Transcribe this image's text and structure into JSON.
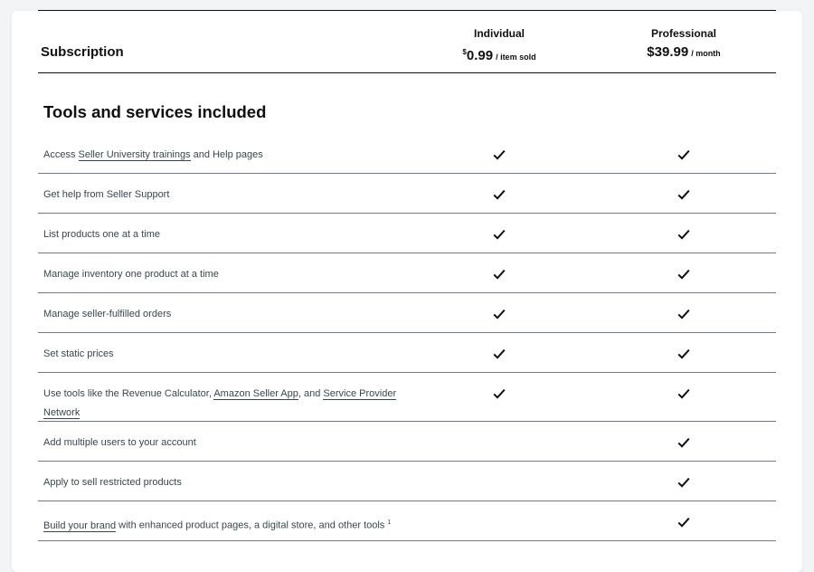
{
  "header": {
    "subscription_label": "Subscription",
    "plans": [
      {
        "name": "Individual",
        "currency": "$",
        "amount": "0.99",
        "period": "/ item sold"
      },
      {
        "name": "Professional",
        "currency": "",
        "amount": "$39.99",
        "period": "/ month"
      }
    ]
  },
  "section_title": "Tools and services included",
  "rows": [
    {
      "parts": [
        "Access ",
        "Seller University trainings",
        " and Help pages"
      ],
      "individual": true,
      "professional": true
    },
    {
      "text": "Get help from Seller Support",
      "individual": true,
      "professional": true
    },
    {
      "text": "List products one at a time",
      "individual": true,
      "professional": true
    },
    {
      "text": "Manage inventory one product at a time",
      "individual": true,
      "professional": true
    },
    {
      "text": "Manage seller-fulfilled orders",
      "individual": true,
      "professional": true
    },
    {
      "text": "Set static prices",
      "individual": true,
      "professional": true
    },
    {
      "parts": [
        "Use tools like the Revenue Calculator, ",
        "Amazon Seller App",
        ", and ",
        "Service Provider Network"
      ],
      "individual": true,
      "professional": true
    },
    {
      "text": "Add multiple users to your account",
      "individual": false,
      "professional": true
    },
    {
      "text": "Apply to sell restricted products",
      "individual": false,
      "professional": true
    },
    {
      "parts": [
        "Build your brand",
        " with enhanced product pages, a digital store, and other tools ",
        "1"
      ],
      "individual": false,
      "professional": true
    }
  ],
  "icons": {
    "check": "checkmark-icon"
  },
  "colors": {
    "text": "#0f1111",
    "row_text": "#37474f",
    "divider": "#6f7a86"
  }
}
